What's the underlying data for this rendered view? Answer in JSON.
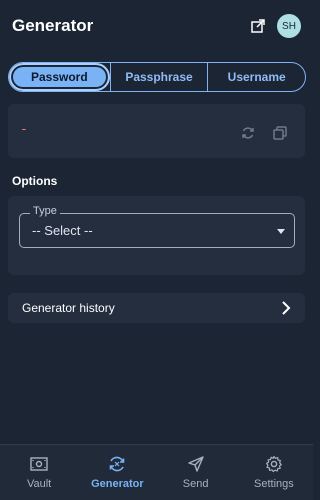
{
  "header": {
    "title": "Generator",
    "avatar_initials": "SH"
  },
  "toggle": {
    "options": [
      "Password",
      "Passphrase",
      "Username"
    ],
    "selected": "Password"
  },
  "password_card": {
    "value": "-"
  },
  "options": {
    "section_label": "Options",
    "type_legend": "Type",
    "type_value": "-- Select --"
  },
  "history": {
    "label": "Generator history"
  },
  "nav": {
    "items": [
      "Vault",
      "Generator",
      "Send",
      "Settings"
    ],
    "active": "Generator"
  },
  "colors": {
    "background": "#1b2533",
    "card": "#242e3e",
    "accent": "#7ab2f6",
    "password_text": "#f2737b"
  }
}
